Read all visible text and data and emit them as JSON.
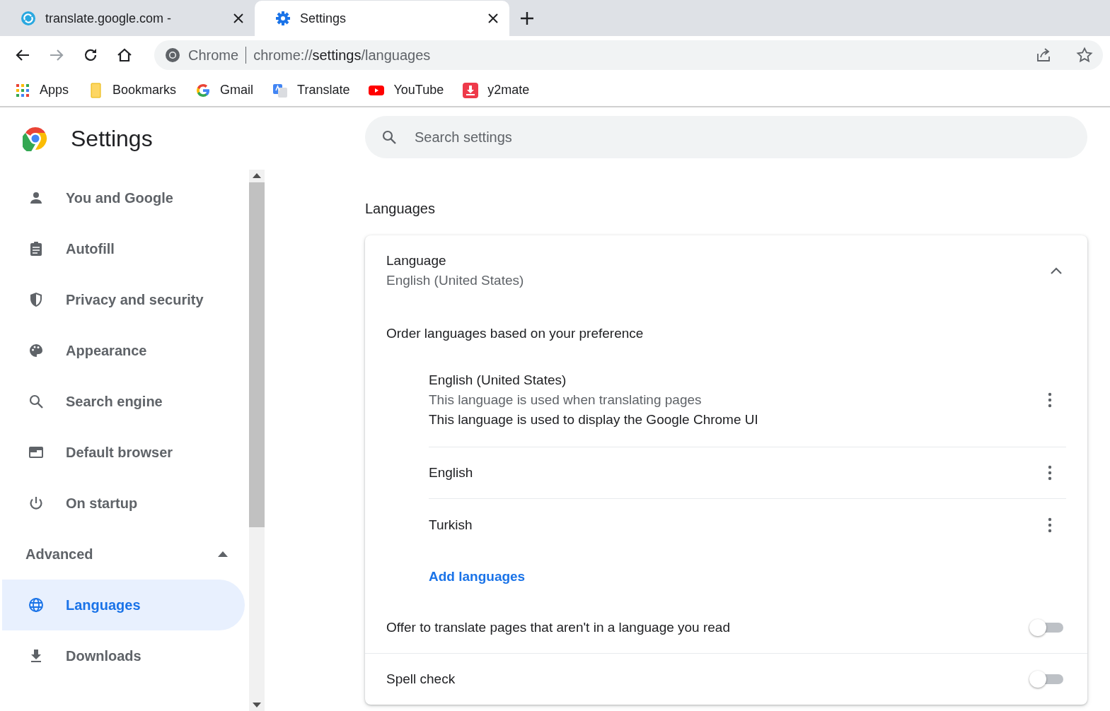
{
  "tabs": [
    {
      "title": "translate.google.com -",
      "selected": false
    },
    {
      "title": "Settings",
      "selected": true
    }
  ],
  "address": {
    "origin": "Chrome",
    "scheme": "chrome://",
    "host": "settings",
    "path": "/languages"
  },
  "bookmarks": [
    {
      "label": "Apps"
    },
    {
      "label": "Bookmarks"
    },
    {
      "label": "Gmail"
    },
    {
      "label": "Translate"
    },
    {
      "label": "YouTube"
    },
    {
      "label": "y2mate"
    }
  ],
  "sidebar": {
    "title": "Settings",
    "items": [
      {
        "label": "You and Google",
        "selected": false
      },
      {
        "label": "Autofill",
        "selected": false
      },
      {
        "label": "Privacy and security",
        "selected": false
      },
      {
        "label": "Appearance",
        "selected": false
      },
      {
        "label": "Search engine",
        "selected": false
      },
      {
        "label": "Default browser",
        "selected": false
      },
      {
        "label": "On startup",
        "selected": false
      }
    ],
    "advanced": {
      "label": "Advanced",
      "expanded": true,
      "items": [
        {
          "label": "Languages",
          "selected": true
        },
        {
          "label": "Downloads",
          "selected": false
        }
      ]
    }
  },
  "search": {
    "placeholder": "Search settings"
  },
  "section_title": "Languages",
  "language": {
    "title": "Language",
    "value": "English (United States)",
    "expanded": true,
    "order_label": "Order languages based on your preference",
    "languages": [
      {
        "name": "English (United States)",
        "notes": [
          {
            "text": "This language is used when translating pages",
            "muted": true
          },
          {
            "text": "This language is used to display the Google Chrome UI",
            "muted": false
          }
        ]
      },
      {
        "name": "English"
      },
      {
        "name": "Turkish"
      }
    ],
    "add_link": "Add languages"
  },
  "toggles": [
    {
      "label": "Offer to translate pages that aren't in a language you read",
      "on": false
    },
    {
      "label": "Spell check",
      "on": false
    }
  ]
}
